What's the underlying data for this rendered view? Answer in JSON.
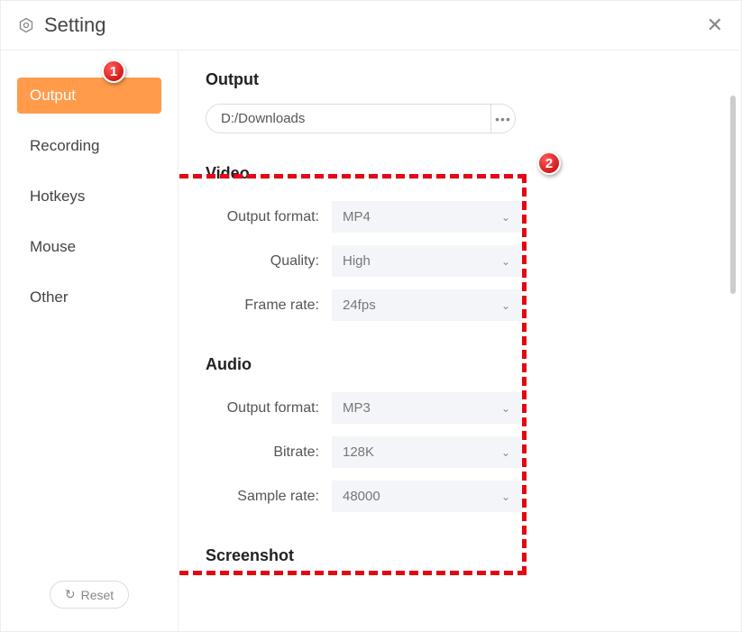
{
  "window": {
    "title": "Setting"
  },
  "sidebar": {
    "items": [
      {
        "label": "Output",
        "active": true
      },
      {
        "label": "Recording",
        "active": false
      },
      {
        "label": "Hotkeys",
        "active": false
      },
      {
        "label": "Mouse",
        "active": false
      },
      {
        "label": "Other",
        "active": false
      }
    ],
    "reset_label": "Reset"
  },
  "content": {
    "output": {
      "heading": "Output",
      "path": "D:/Downloads"
    },
    "video": {
      "heading": "Video",
      "fields": {
        "output_format": {
          "label": "Output format:",
          "value": "MP4"
        },
        "quality": {
          "label": "Quality:",
          "value": "High"
        },
        "frame_rate": {
          "label": "Frame rate:",
          "value": "24fps"
        }
      }
    },
    "audio": {
      "heading": "Audio",
      "fields": {
        "output_format": {
          "label": "Output format:",
          "value": "MP3"
        },
        "bitrate": {
          "label": "Bitrate:",
          "value": "128K"
        },
        "sample_rate": {
          "label": "Sample rate:",
          "value": "48000"
        }
      }
    },
    "screenshot": {
      "heading": "Screenshot"
    }
  },
  "annotations": {
    "badge1": "1",
    "badge2": "2"
  }
}
